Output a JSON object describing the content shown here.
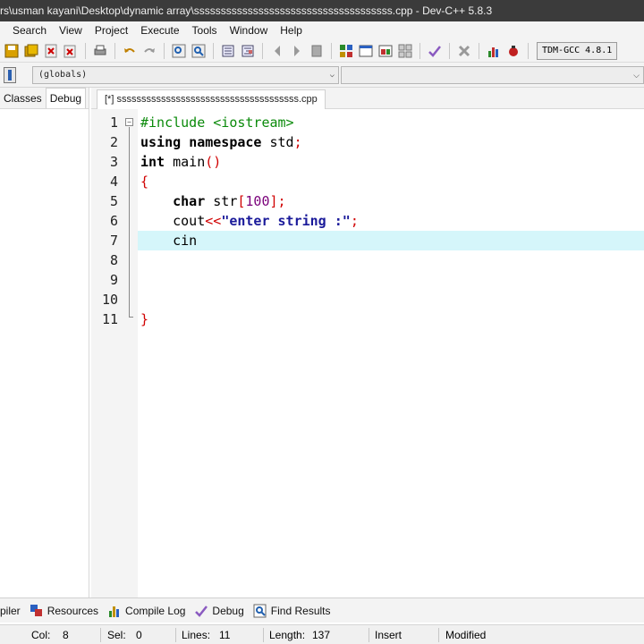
{
  "window": {
    "title": "rs\\usman kayani\\Desktop\\dynamic array\\sssssssssssssssssssssssssssssssssssss.cpp - Dev-C++ 5.8.3"
  },
  "menu": [
    "Search",
    "View",
    "Project",
    "Execute",
    "Tools",
    "Window",
    "Help"
  ],
  "toolbar": {
    "compiler": "TDM-GCC 4.8.1"
  },
  "toolbar2": {
    "globals": "(globals)",
    "chevron": "⌵"
  },
  "left_panel": {
    "tabs": [
      "Classes",
      "Debug"
    ]
  },
  "editor": {
    "tab": "[*] sssssssssssssssssssssssssssssssssssss.cpp",
    "line_numbers": [
      "1",
      "2",
      "3",
      "4",
      "5",
      "6",
      "7",
      "8",
      "9",
      "10",
      "11"
    ],
    "fold_toggle": "−",
    "lines": [
      {
        "t1": "#include <iostream>"
      },
      {
        "t1": "using",
        "t2": " ",
        "t3": "namespace",
        "t4": " std",
        "t5": ";"
      },
      {
        "t1": "int",
        "t2": " main",
        "t3": "()"
      },
      {
        "t1": "{"
      },
      {
        "t1": "    ",
        "t2": "char",
        "t3": " str",
        "t4": "[",
        "t5": "100",
        "t6": "];"
      },
      {
        "t1": "    cout",
        "t2": "<<",
        "t3": "\"enter string :\"",
        "t4": ";"
      },
      {
        "t1": "    cin"
      },
      {
        "t1": ""
      },
      {
        "t1": ""
      },
      {
        "t1": ""
      },
      {
        "t1": "}"
      }
    ],
    "current_line": 7
  },
  "bottom_tabs": [
    "piler",
    "Resources",
    "Compile Log",
    "Debug",
    "Find Results"
  ],
  "status": {
    "col_label": "Col:",
    "col": "8",
    "sel_label": "Sel:",
    "sel": "0",
    "lines_label": "Lines:",
    "lines": "11",
    "length_label": "Length:",
    "length": "137",
    "mode": "Insert",
    "state": "Modified"
  },
  "colors": {
    "titlebar": "#3b3b3b",
    "current_line": "#d5f6fa",
    "preprocessor": "#0a8a0a",
    "operator": "#d00000",
    "string": "#1a1a9a"
  }
}
